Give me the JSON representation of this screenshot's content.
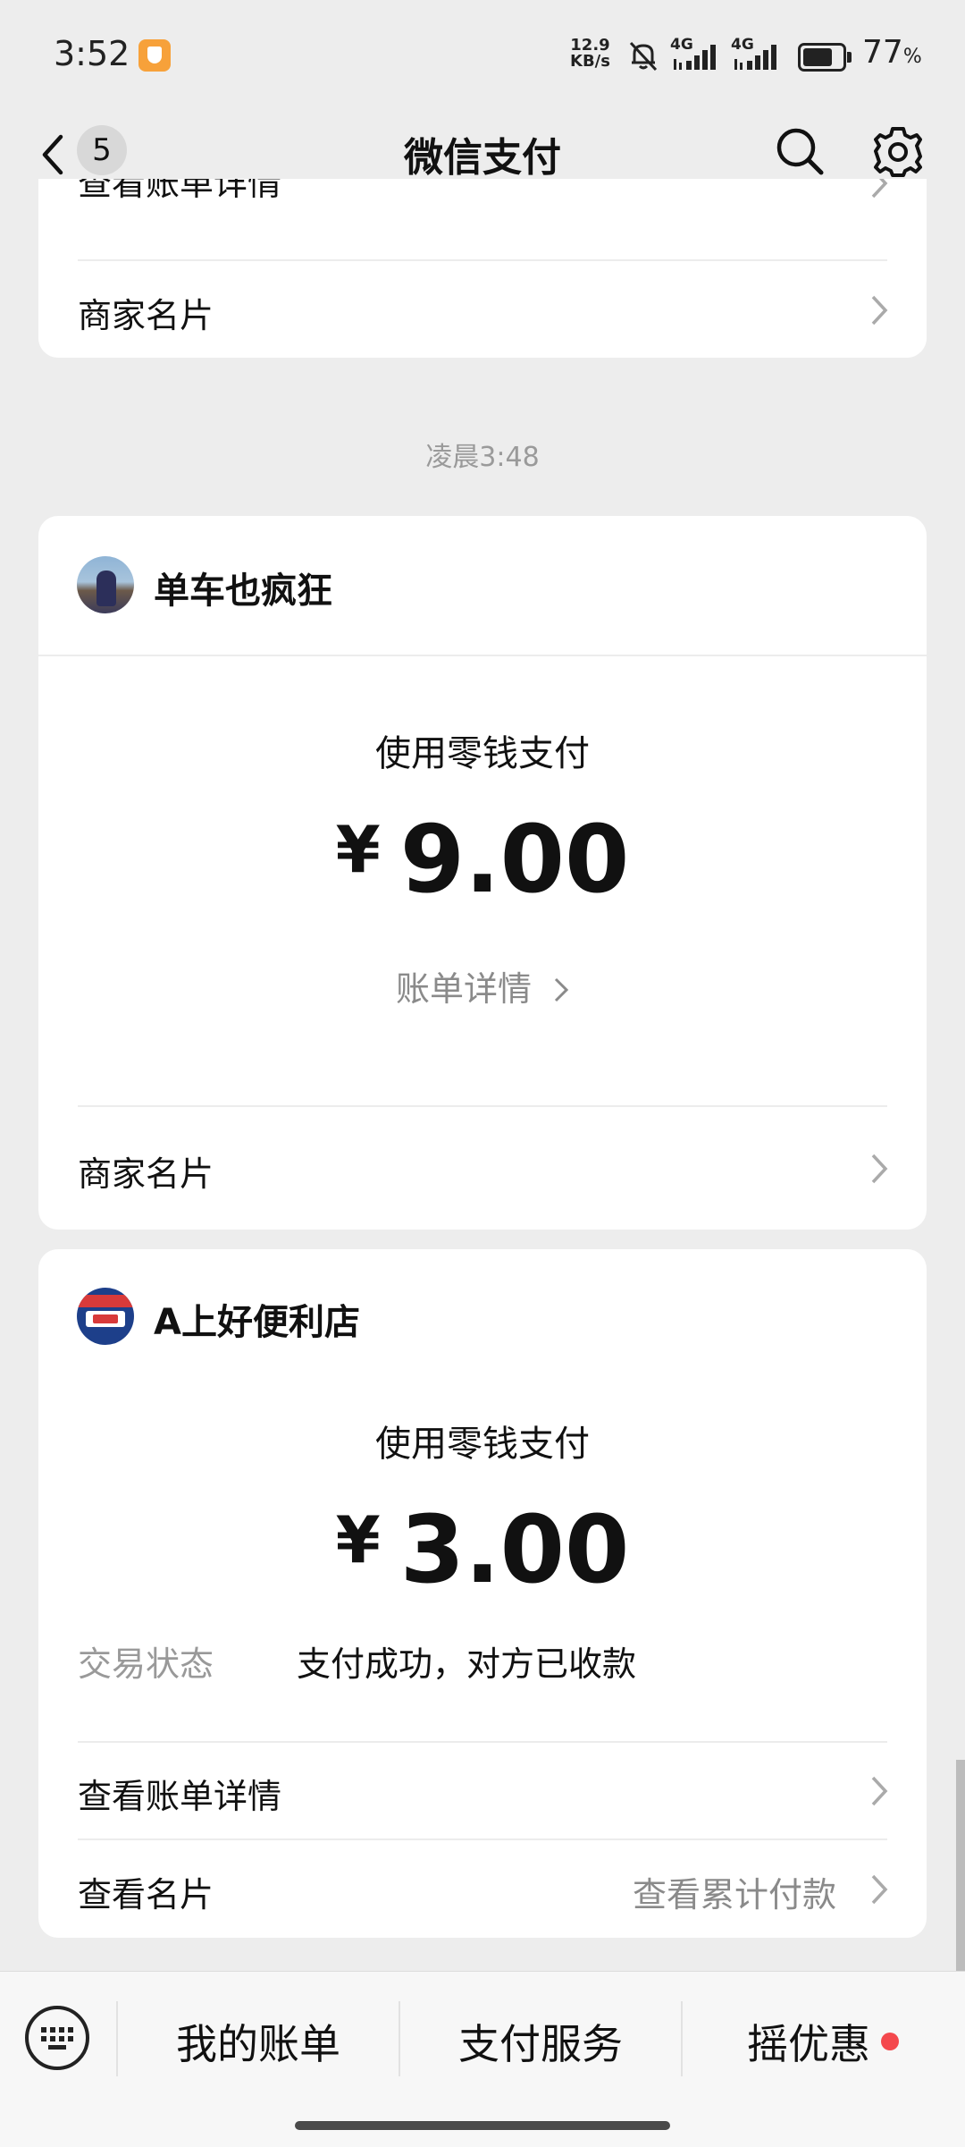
{
  "status_bar": {
    "time": "3:52",
    "net_speed_value": "12.9",
    "net_speed_unit": "KB/s",
    "signal_1": "4G",
    "signal_2": "4G",
    "battery": "77",
    "battery_unit": "%"
  },
  "header": {
    "back_count": "5",
    "title": "微信支付"
  },
  "card_top": {
    "partial_link": "查看账单详情",
    "merchant_card": "商家名片"
  },
  "timestamp": "凌晨3:48",
  "card1": {
    "merchant": "单车也疯狂",
    "method": "使用零钱支付",
    "currency": "¥",
    "amount": "9.00",
    "bill_detail": "账单详情",
    "merchant_card": "商家名片"
  },
  "card2": {
    "merchant": "A上好便利店",
    "method": "使用零钱支付",
    "currency": "¥",
    "amount": "3.00",
    "status_label": "交易状态",
    "status_value": "支付成功，对方已收款",
    "view_bill": "查看账单详情",
    "view_card": "查看名片",
    "view_cumulative": "查看累计付款"
  },
  "bottom_tabs": {
    "tab1": "我的账单",
    "tab2": "支付服务",
    "tab3": "摇优惠"
  },
  "colors": {
    "background": "#ededed",
    "card": "#ffffff",
    "muted_text": "#999999",
    "red_dot": "#f4484d"
  },
  "icons": [
    "back-icon",
    "search-icon",
    "gear-icon",
    "chevron-right-icon",
    "keyboard-icon",
    "bell-muted-icon",
    "battery-icon"
  ]
}
